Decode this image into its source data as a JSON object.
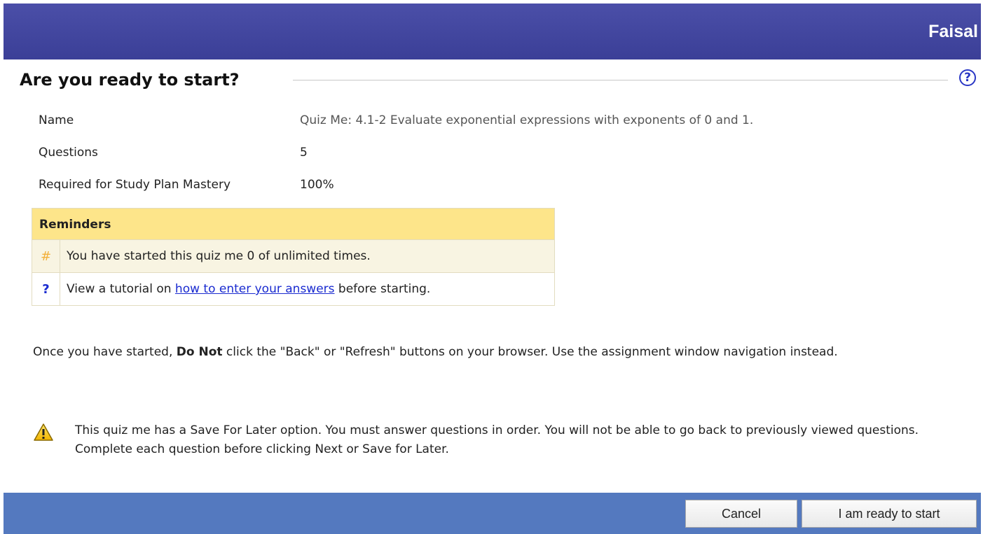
{
  "header": {
    "user_name": "Faisal"
  },
  "page": {
    "title": "Are you ready to start?",
    "help_icon": "help-circle-icon"
  },
  "assignment": {
    "name_label": "Name",
    "name_value": "Quiz Me: 4.1-2 Evaluate exponential expressions with exponents of 0 and 1.",
    "questions_label": "Questions",
    "questions_value": "5",
    "mastery_label": "Required for Study Plan Mastery",
    "mastery_value": "100%"
  },
  "reminders": {
    "header": "Reminders",
    "attempts_icon": "#",
    "attempts_text": "You have started this quiz me 0 of unlimited times.",
    "tutorial_icon": "?",
    "tutorial_prefix": "View a tutorial on ",
    "tutorial_link": "how to enter your answers",
    "tutorial_suffix": " before starting."
  },
  "notices": {
    "browser_prefix": "Once you have started, ",
    "browser_bold": "Do Not",
    "browser_suffix": " click the \"Back\" or \"Refresh\" buttons on your browser. Use the assignment window navigation instead.",
    "save_later_icon": "warning-icon",
    "save_later_text": "This quiz me has a Save For Later option. You must answer questions in order. You will not be able to go back to previously viewed questions. Complete each question before clicking Next or Save for Later."
  },
  "footer": {
    "cancel_label": "Cancel",
    "start_label": "I am ready to start"
  },
  "colors": {
    "header_bar": "#3f43a0",
    "footer_bar": "#5479bf",
    "reminders_header": "#fde58a",
    "link": "#1a2bd0",
    "hash_icon": "#f2b03a"
  }
}
